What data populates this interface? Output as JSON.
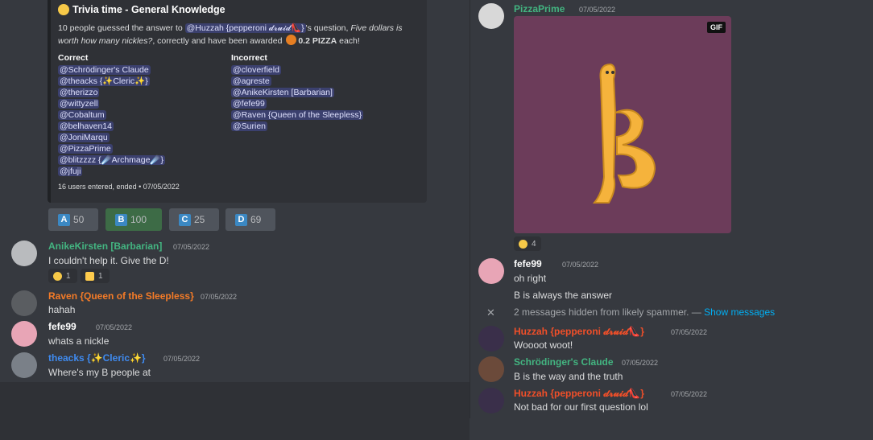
{
  "embed": {
    "title": "Trivia time - General Knowledge",
    "desc_pre": "10 people guessed the answer to ",
    "desc_mention": "@Huzzah {pepperoni 𝓭𝓻𝓾𝓲𝓭👠}",
    "desc_mid": "'s question, ",
    "desc_question": "Five dollars is worth how many nickles?",
    "desc_post": ", correctly and have been awarded ",
    "desc_award": "0.2 PIZZA",
    "desc_end": " each!",
    "correct_label": "Correct",
    "correct": [
      "@Schrödinger's Claude",
      "@theacks {✨Cleric✨}",
      "@therizzo",
      "@wittyzell",
      "@Cobaltum",
      "@belhaven14",
      "@JoniMarqu",
      "@PizzaPrime",
      "@blitzzzz {☄️Archmage☄️}",
      "@jfuji"
    ],
    "incorrect_label": "Incorrect",
    "incorrect": [
      "@cloverfield",
      "@agreste",
      "@AnikeKirsten [Barbarian]",
      "@fefe99",
      "@Raven {Queen of the Sleepless}",
      "@Surien"
    ],
    "footer": "16 users entered, ended • 07/05/2022"
  },
  "buttons": [
    {
      "letter": "A",
      "count": "50"
    },
    {
      "letter": "B",
      "count": "100"
    },
    {
      "letter": "C",
      "count": "25"
    },
    {
      "letter": "D",
      "count": "69"
    }
  ],
  "left_messages": [
    {
      "user": "AnikeKirsten [Barbarian]",
      "color": "#43b581",
      "time": "07/05/2022",
      "text": "I couldn't help it. Give the D!",
      "reactions": [
        {
          "icon": "rofl-emoji",
          "count": "1"
        },
        {
          "icon": "thumbsup-emoji",
          "count": "1"
        }
      ]
    },
    {
      "user": "Raven {Queen of the Sleepless}",
      "color": "#f47b27",
      "time": "07/05/2022",
      "text": "hahah"
    },
    {
      "user": "fefe99",
      "color": "#ffffff",
      "time": "07/05/2022",
      "text": "whats a nickle"
    },
    {
      "user": "theacks {✨Cleric✨}",
      "color": "#3f8bf0",
      "time": "07/05/2022",
      "text": "Where's my B people at"
    }
  ],
  "right": {
    "pizza_user": "PizzaPrime",
    "pizza_color": "#43b581",
    "pizza_time": "07/05/2022",
    "gif_label": "GIF",
    "gif_reaction": {
      "icon": "rofl-emoji",
      "count": "4"
    },
    "fefe_user": "fefe99",
    "fefe_time": "07/05/2022",
    "fefe_line1": "oh right",
    "fefe_line2": "B is always the answer",
    "hidden_text": "2 messages hidden from likely spammer. — ",
    "hidden_link": "Show messages",
    "huzzah_user": "Huzzah {pepperoni 𝓭𝓻𝓾𝓲𝓭👠}",
    "huzzah_color": "#f04f29",
    "huzzah_time1": "07/05/2022",
    "huzzah_text1": "Woooot woot!",
    "claude_user": "Schrödinger's Claude",
    "claude_color": "#43b581",
    "claude_time": "07/05/2022",
    "claude_text": "B is the way and the truth",
    "huzzah_time2": "07/05/2022",
    "huzzah_text2": "Not bad for our first question lol"
  },
  "colors": {
    "background": "#36393f",
    "embed_bg": "#2f3136",
    "mention_bg": "#3c4270",
    "button_bg": "#4f545c",
    "button_selected": "#3d6b46"
  }
}
